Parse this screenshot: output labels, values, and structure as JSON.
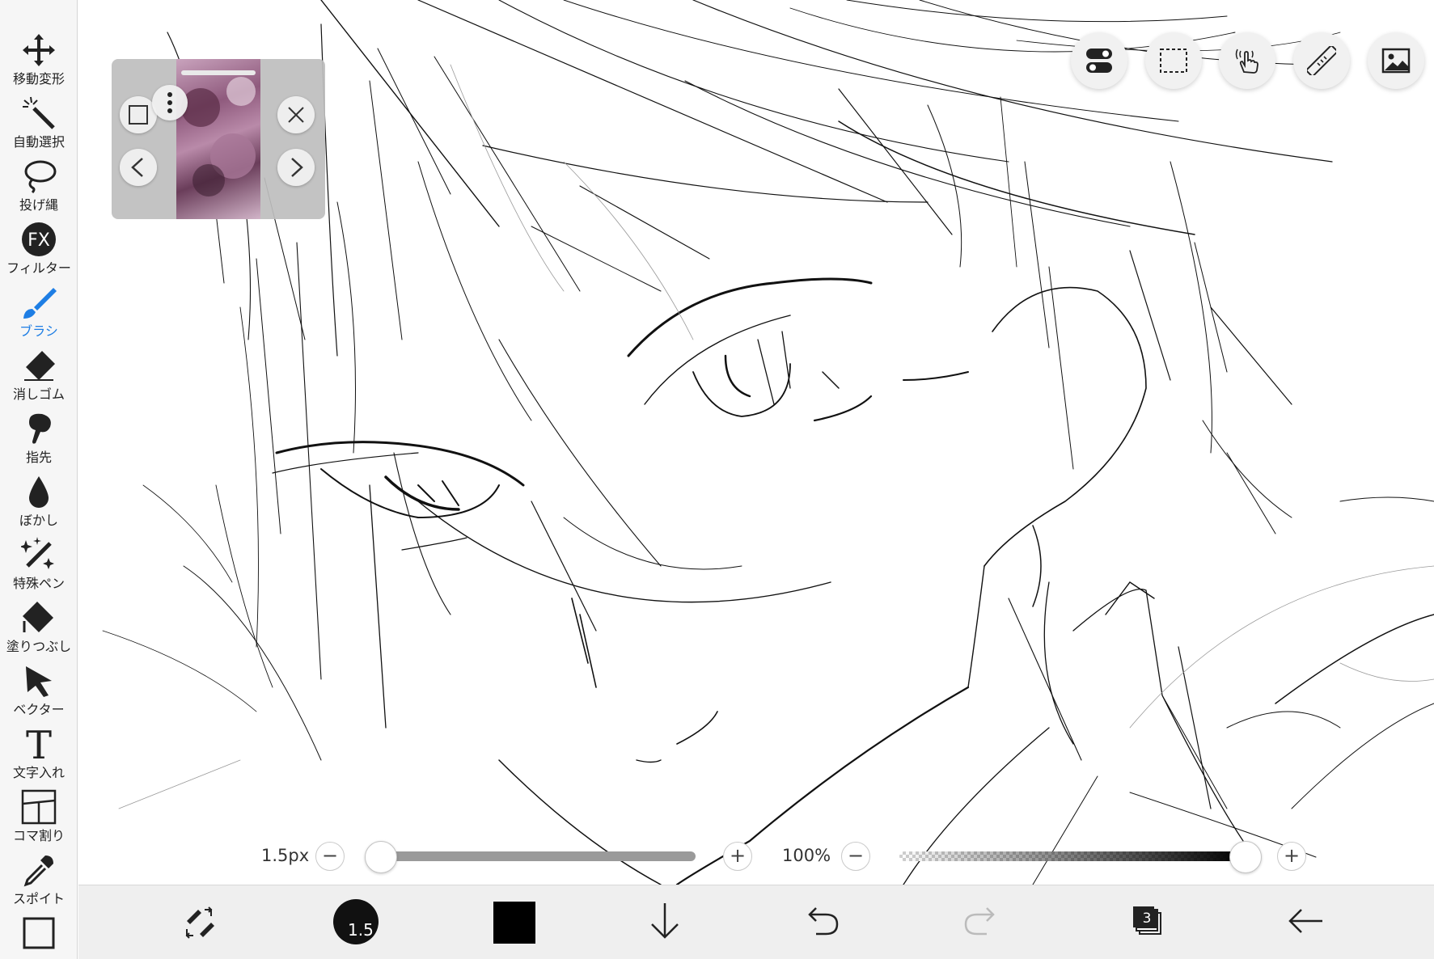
{
  "toolbar": {
    "tools": [
      {
        "label": "移動変形",
        "icon": "move-icon"
      },
      {
        "label": "自動選択",
        "icon": "magic-wand-icon"
      },
      {
        "label": "投げ縄",
        "icon": "lasso-icon"
      },
      {
        "label": "フィルター",
        "icon": "fx-icon",
        "glyph": "FX"
      },
      {
        "label": "ブラシ",
        "icon": "brush-icon",
        "active": true
      },
      {
        "label": "消しゴム",
        "icon": "eraser-icon"
      },
      {
        "label": "指先",
        "icon": "finger-icon"
      },
      {
        "label": "ぼかし",
        "icon": "blur-drop-icon"
      },
      {
        "label": "特殊ペン",
        "icon": "special-pen-icon"
      },
      {
        "label": "塗りつぶし",
        "icon": "fill-bucket-icon"
      },
      {
        "label": "ベクター",
        "icon": "vector-arrow-icon"
      },
      {
        "label": "文字入れ",
        "icon": "text-icon",
        "glyph": "T"
      },
      {
        "label": "コマ割り",
        "icon": "frame-divider-icon"
      },
      {
        "label": "スポイト",
        "icon": "eyedropper-icon"
      }
    ],
    "active_color": "#1e7ee4"
  },
  "reference_window": {
    "image": "reference-thumbnail",
    "buttons": [
      "fullscreen-icon",
      "more-icon",
      "close-icon",
      "previous-icon",
      "next-icon"
    ]
  },
  "top_buttons": [
    "toggle-settings-icon",
    "selection-icon",
    "touch-gesture-icon",
    "ruler-icon",
    "material-image-icon"
  ],
  "brush_size": {
    "label": "1.5px",
    "value_fraction": 0.0,
    "minus": "−",
    "plus": "+"
  },
  "opacity": {
    "label": "100%",
    "value_fraction": 1.0,
    "minus": "−",
    "plus": "+"
  },
  "bottom_bar": {
    "brush_size_display": "1.5",
    "primary_color": "#000000",
    "layer_count": "3",
    "icons": [
      "swap-tools-icon",
      "brush-size-indicator",
      "color-swatch",
      "download-icon",
      "undo-icon",
      "redo-icon",
      "layers-icon",
      "back-arrow-icon"
    ]
  }
}
